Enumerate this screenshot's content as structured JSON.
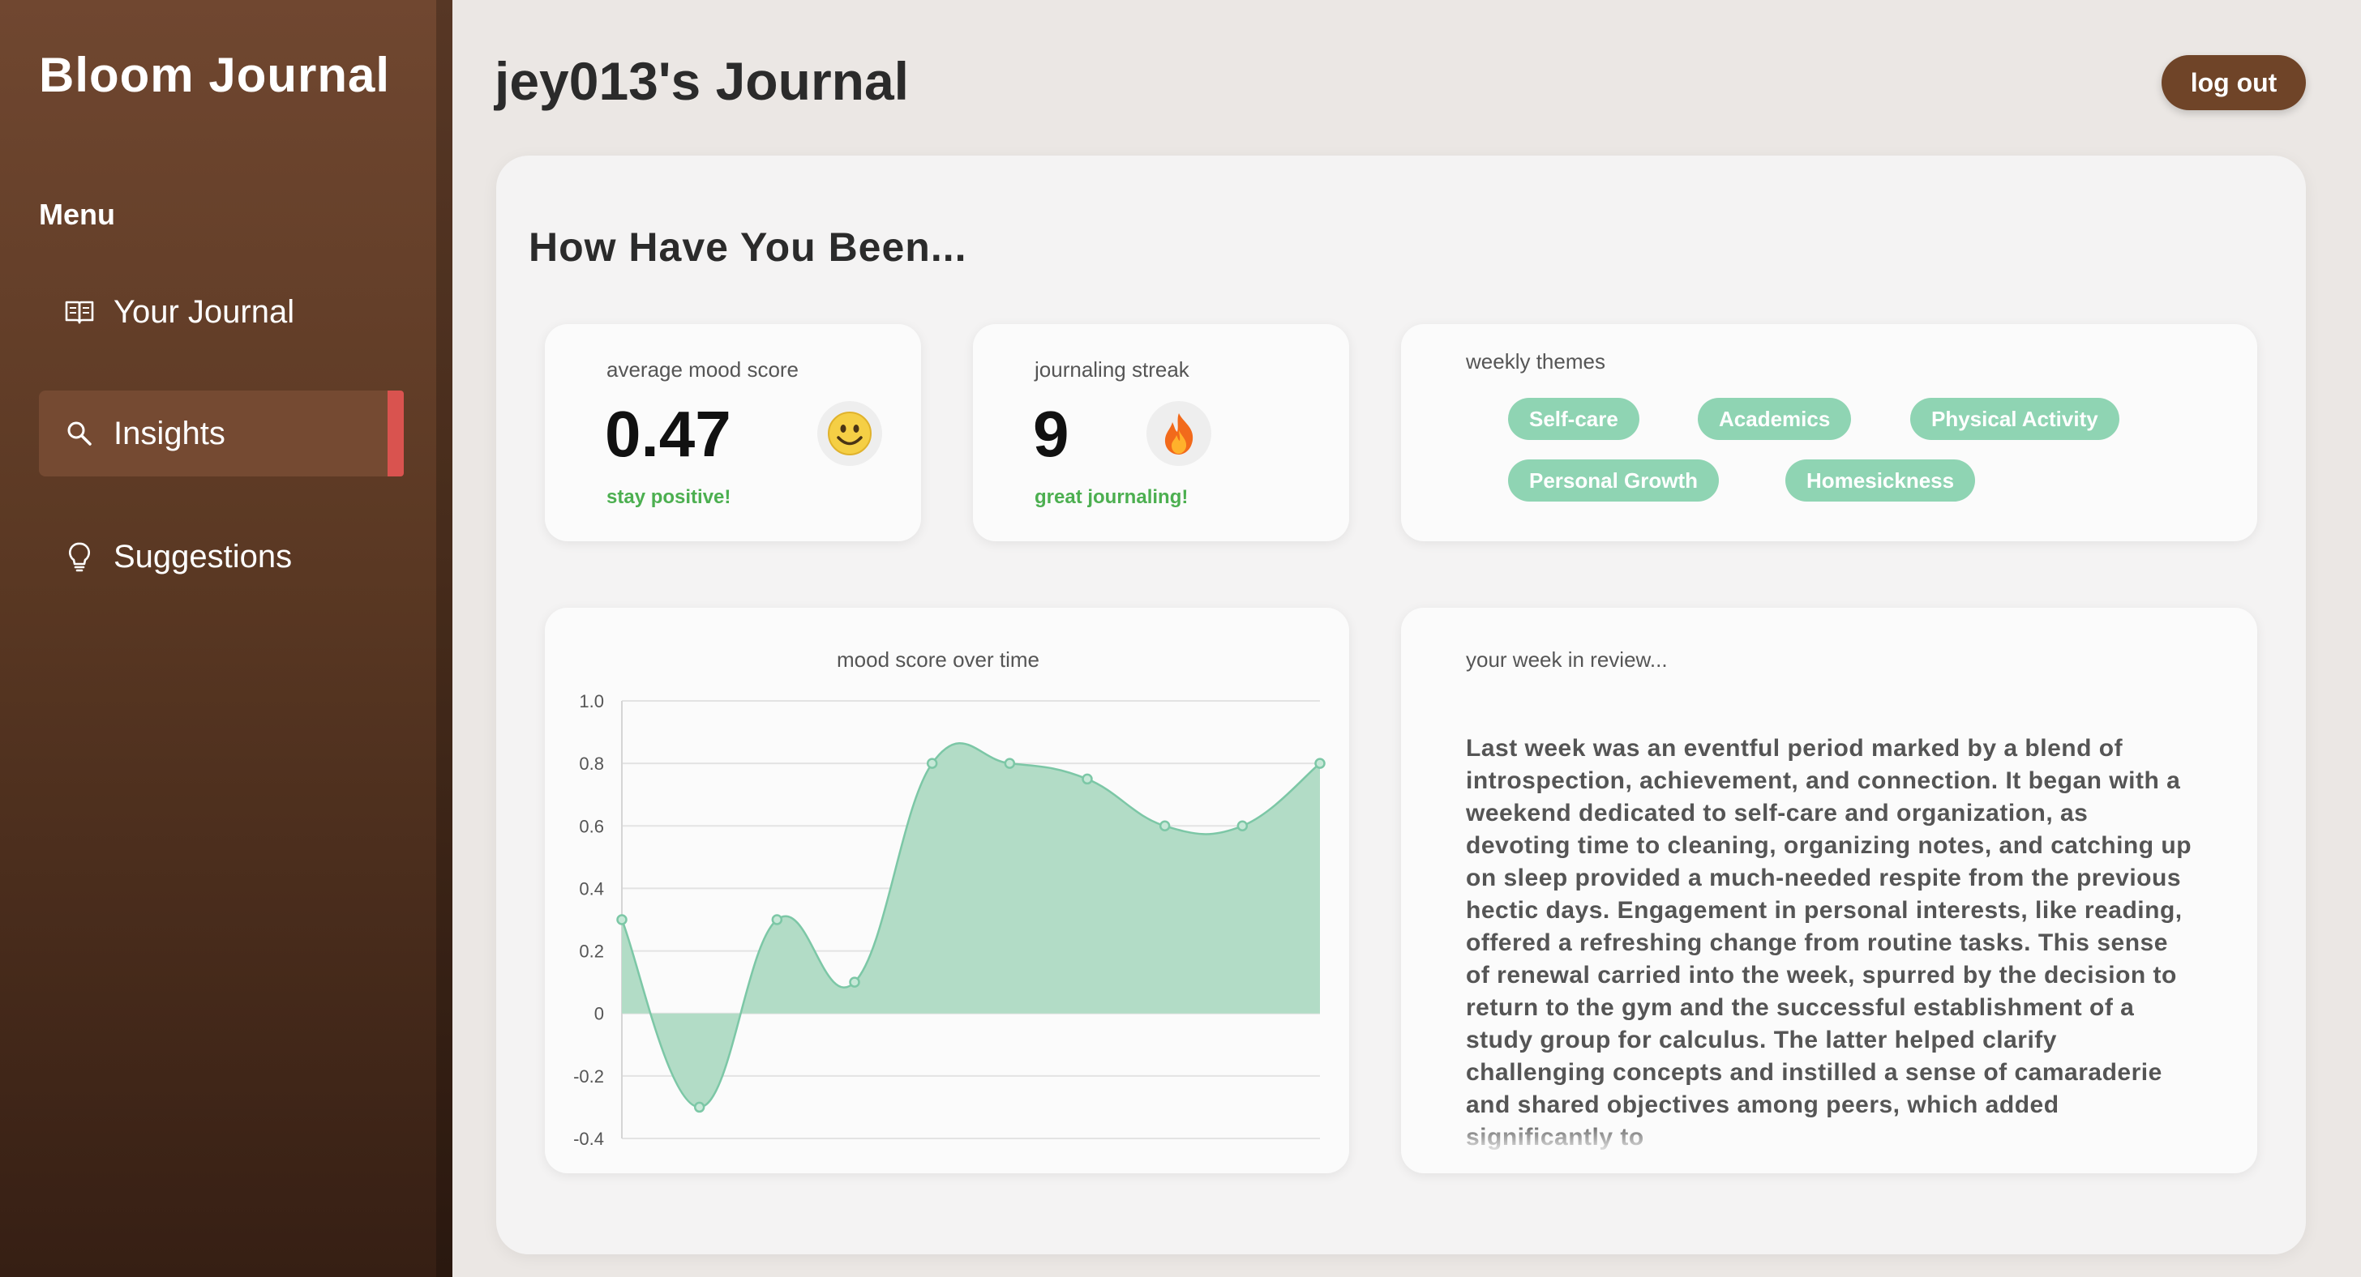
{
  "app": {
    "brand": "Bloom Journal"
  },
  "sidebar": {
    "menu_heading": "Menu",
    "items": [
      {
        "label": "Your Journal",
        "icon": "book-icon",
        "active": false
      },
      {
        "label": "Insights",
        "icon": "search-icon",
        "active": true
      },
      {
        "label": "Suggestions",
        "icon": "lightbulb-icon",
        "active": false
      }
    ]
  },
  "header": {
    "title": "jey013's Journal",
    "logout_label": "log out"
  },
  "main": {
    "section_title": "How Have You Been...",
    "mood": {
      "label": "average mood score",
      "value": "0.47",
      "note": "stay positive!",
      "icon": "smiley-icon"
    },
    "streak": {
      "label": "journaling streak",
      "value": "9",
      "note": "great journaling!",
      "icon": "fire-icon"
    },
    "themes": {
      "label": "weekly themes",
      "items": [
        "Self-care",
        "Academics",
        "Physical Activity",
        "Personal Growth",
        "Homesickness"
      ]
    },
    "review": {
      "label": "your week in review...",
      "text": "Last week was an eventful period marked by a blend of introspection, achievement, and connection. It began with a weekend dedicated to self-care and organization, as devoting time to cleaning, organizing notes, and catching up on sleep provided a much-needed respite from the previous hectic days. Engagement in personal interests, like reading, offered a refreshing change from routine tasks. This sense of renewal carried into the week, spurred by the decision to return to the gym and the successful establishment of a study group for calculus. The latter helped clarify challenging concepts and instilled a sense of camaraderie and shared objectives among peers, which added significantly to"
    }
  },
  "chart_data": {
    "type": "area",
    "title": "mood score over time",
    "x": [
      1,
      2,
      3,
      4,
      5,
      6,
      7,
      8,
      9,
      10
    ],
    "values": [
      0.3,
      -0.3,
      0.3,
      0.1,
      0.8,
      0.8,
      0.75,
      0.6,
      0.6,
      0.8
    ],
    "ylim": [
      -0.4,
      1.0
    ],
    "yticks": [
      "1.0",
      "0.8",
      "0.6",
      "0.4",
      "0.2",
      "0",
      "-0.2",
      "-0.4"
    ],
    "grid": true,
    "colors": {
      "fill": "#b2dcc6",
      "line": "#7cc7a6"
    }
  },
  "colors": {
    "accent": "#8fd4b3",
    "brand_brown": "#6f4428",
    "active_marker": "#d9534f",
    "positive": "#4caf50"
  }
}
